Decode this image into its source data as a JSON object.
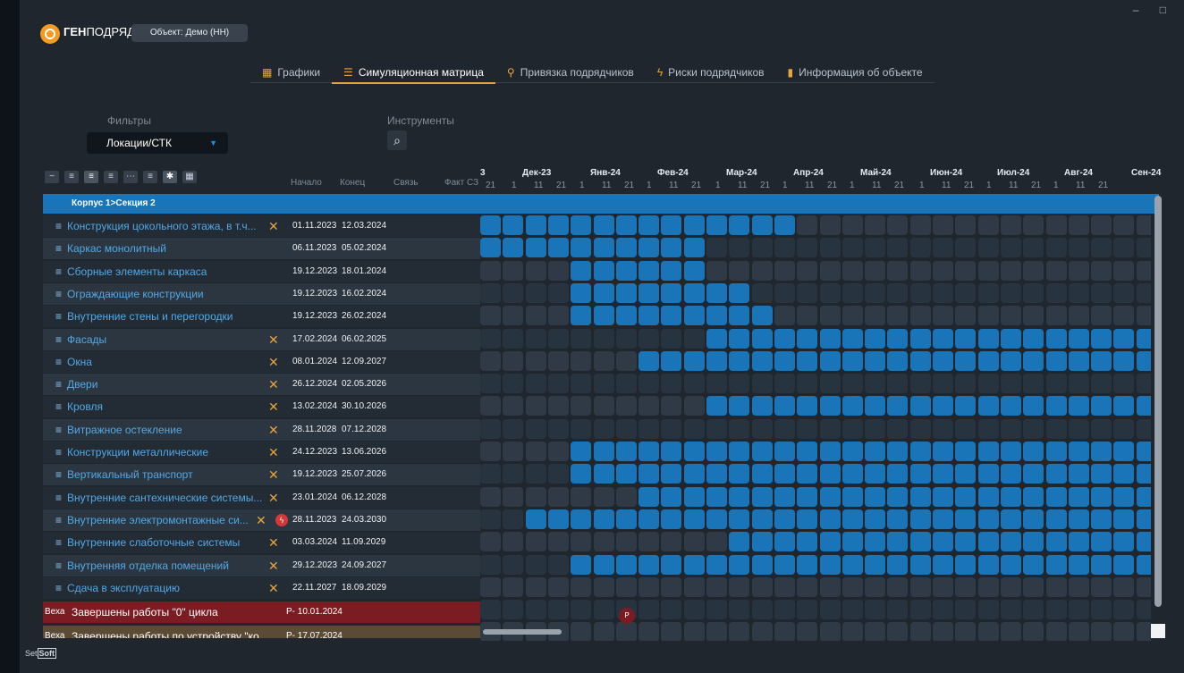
{
  "window_controls": "– □",
  "brand": {
    "bold": "ГЕН",
    "rest": "ПОДРЯД"
  },
  "object_button": "Объект: Демо (НН)",
  "tabs": [
    {
      "label": "Графики",
      "icon": "calendar-icon",
      "active": false
    },
    {
      "label": "Симуляционная матрица",
      "icon": "matrix-icon",
      "active": true
    },
    {
      "label": "Привязка подрядчиков",
      "icon": "user-link-icon",
      "active": false
    },
    {
      "label": "Риски подрядчиков",
      "icon": "lightning-icon",
      "active": false
    },
    {
      "label": "Информация об объекте",
      "icon": "document-icon",
      "active": false
    }
  ],
  "filters": {
    "label": "Фильтры",
    "value": "Локации/СТК"
  },
  "tools": {
    "label": "Инструменты",
    "search_icon": "search-icon"
  },
  "columns": {
    "start": "Начало",
    "end": "Конец",
    "link": "Связь",
    "fact": "Факт СЗ"
  },
  "timeline": {
    "months": [
      "Дек-23",
      "Янв-24",
      "Фев-24",
      "Мар-24",
      "Апр-24",
      "Май-24",
      "Июн-24",
      "Июл-24",
      "Авг-24",
      "Сен-24"
    ],
    "partial": "3",
    "first_day": "21",
    "days": [
      "1",
      "11",
      "21"
    ]
  },
  "section": "Корпус 1>Секция 2",
  "rows": [
    {
      "name": "Конструкция цокольного этажа, в т.ч...",
      "start": "01.11.2023",
      "end": "12.03.2024",
      "warn": true,
      "bolt": false
    },
    {
      "name": "Каркас монолитный",
      "start": "06.11.2023",
      "end": "05.02.2024",
      "warn": false,
      "bolt": false
    },
    {
      "name": "Сборные элементы каркаса",
      "start": "19.12.2023",
      "end": "18.01.2024",
      "warn": false,
      "bolt": false
    },
    {
      "name": "Ограждающие конструкции",
      "start": "19.12.2023",
      "end": "16.02.2024",
      "warn": false,
      "bolt": false
    },
    {
      "name": "Внутренние стены и перегородки",
      "start": "19.12.2023",
      "end": "26.02.2024",
      "warn": false,
      "bolt": false
    },
    {
      "name": "Фасады",
      "start": "17.02.2024",
      "end": "06.02.2025",
      "warn": true,
      "bolt": false
    },
    {
      "name": "Окна",
      "start": "08.01.2024",
      "end": "12.09.2027",
      "warn": true,
      "bolt": false
    },
    {
      "name": "Двери",
      "start": "26.12.2024",
      "end": "02.05.2026",
      "warn": true,
      "bolt": false
    },
    {
      "name": "Кровля",
      "start": "13.02.2024",
      "end": "30.10.2026",
      "warn": true,
      "bolt": false
    },
    {
      "name": "Витражное остекление",
      "start": "28.11.2028",
      "end": "07.12.2028",
      "warn": true,
      "bolt": false
    },
    {
      "name": "Конструкции металлические",
      "start": "24.12.2023",
      "end": "13.06.2026",
      "warn": true,
      "bolt": false
    },
    {
      "name": "Вертикальный транспорт",
      "start": "19.12.2023",
      "end": "25.07.2026",
      "warn": true,
      "bolt": false
    },
    {
      "name": "Внутренние сантехнические системы...",
      "start": "23.01.2024",
      "end": "06.12.2028",
      "warn": true,
      "bolt": false
    },
    {
      "name": "Внутренние электромонтажные си...",
      "start": "28.11.2023",
      "end": "24.03.2030",
      "warn": true,
      "bolt": true
    },
    {
      "name": "Внутренние слаботочные системы",
      "start": "03.03.2024",
      "end": "11.09.2029",
      "warn": true,
      "bolt": false
    },
    {
      "name": "Внутренняя отделка помещений",
      "start": "29.12.2023",
      "end": "24.09.2027",
      "warn": true,
      "bolt": false
    },
    {
      "name": "Сдача в эксплуатацию",
      "start": "22.11.2027",
      "end": "18.09.2029",
      "warn": true,
      "bolt": false
    }
  ],
  "milestones": [
    {
      "tag": "Веха",
      "name": "Завершены работы \"0\" цикла",
      "date": "Р- 10.01.2024",
      "marker": "Р"
    },
    {
      "tag": "Веха",
      "name": "Завершены работы по устройству \"ко",
      "date": "Р- 17.07.2024"
    }
  ],
  "matrix": [
    "11111111111111",
    "1111111111",
    "0000111111",
    "000011111111",
    "0000111111111",
    "000000000011111111111111111111",
    "000000011111111111111111111111",
    "000000000000000000000000000000",
    "000000000011111111111111111111",
    "000000000000000000000000000000",
    "000011111111111111111111111111",
    "000011111111111111111111111111",
    "000000011111111111111111111111",
    "001111111111111111111111111111",
    "000000000001111111111111111111",
    "000011111111111111111111111111",
    "000000000000000000000000000000"
  ],
  "colors": {
    "accent": "#1a74b8",
    "warning": "#e8a43b",
    "milestone_red": "#7a1c22"
  },
  "footer": {
    "a": "Set",
    "b": "Soft"
  }
}
